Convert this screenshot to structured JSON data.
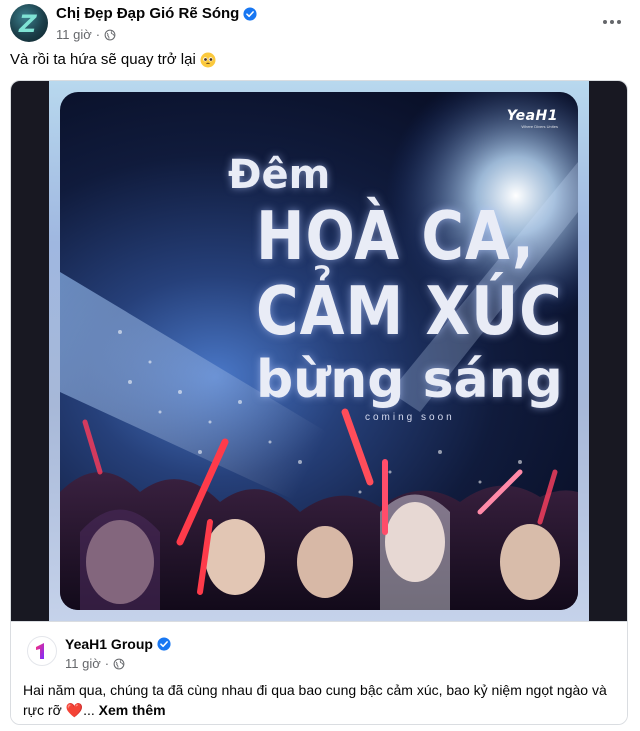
{
  "post": {
    "author": "Chị Đẹp Đạp Gió Rẽ Sóng",
    "time": "11 giờ",
    "dot": "·",
    "text": "Và rồi ta hứa sẽ quay trở lại",
    "more_icon": "more-horizontal-icon",
    "privacy_icon": "globe-icon"
  },
  "poster": {
    "brand": "YeaH1",
    "tagline": "Where Divers Unites",
    "line1": "Đêm",
    "line2": "HOÀ CA,",
    "line3": "CẢM XÚC",
    "line4": "bừng sáng",
    "coming": "coming soon"
  },
  "shared": {
    "group_name": "YeaH1 Group",
    "time": "11 giờ",
    "dot": "·",
    "text": "Hai năm qua, chúng ta đã cùng nhau đi qua bao cung bậc cảm xúc, bao kỷ niệm ngọt ngào và rực rỡ",
    "heart": "❤️",
    "ellipsis": "...",
    "see_more": "Xem thêm"
  },
  "colors": {
    "verified": "#1877f2",
    "meta": "#65676b",
    "text": "#050505"
  }
}
